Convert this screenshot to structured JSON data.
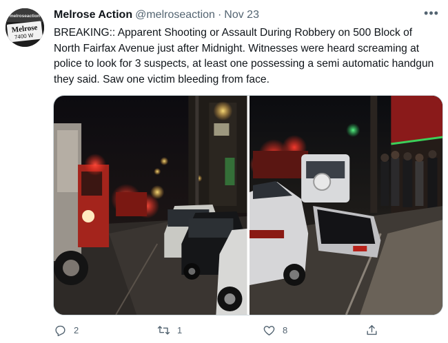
{
  "tweet": {
    "display_name": "Melrose Action",
    "handle": "@melroseaction",
    "separator": "·",
    "date": "Nov 23",
    "avatar_text_top": "melroseaction",
    "avatar_sign_word": "Melrose",
    "avatar_sign_number": "7400 W",
    "more_label": "•••",
    "text": "BREAKING:: Apparent Shooting or Assault During Robbery on 500 Block of North Fairfax Avenue just after Midnight. Witnesses were heard screaming at police to look for 3 suspects, at least one possessing a semi automatic handgun they said. Saw one victim bleeding from face."
  },
  "photos": [
    {
      "name": "street-fire-truck-photo"
    },
    {
      "name": "damaged-car-open-door-photo"
    }
  ],
  "actions": {
    "reply_count": "2",
    "retweet_count": "1",
    "like_count": "8",
    "share_count": ""
  },
  "colors": {
    "text": "#0f1419",
    "secondary": "#536471",
    "border": "#cfd9de"
  }
}
